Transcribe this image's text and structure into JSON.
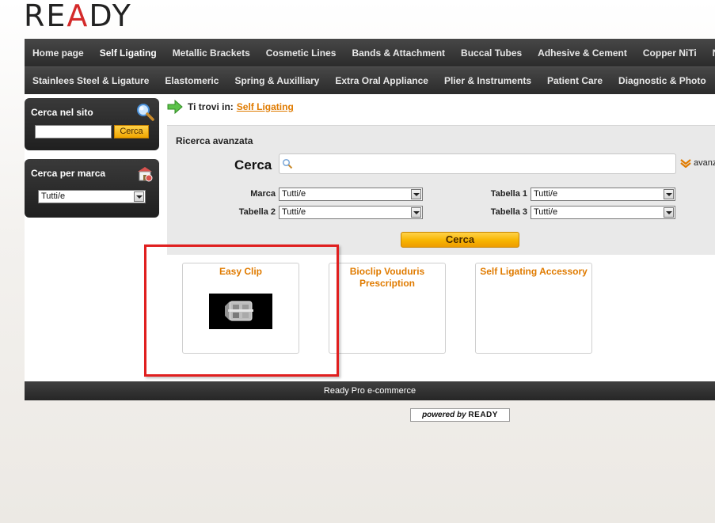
{
  "logo": {
    "text_pre": "RE",
    "text_accent": "A",
    "text_post": "DY"
  },
  "nav_primary": [
    {
      "label": "Home page",
      "active": false
    },
    {
      "label": "Self Ligating",
      "active": true
    },
    {
      "label": "Metallic Brackets",
      "active": false
    },
    {
      "label": "Cosmetic Lines",
      "active": false
    },
    {
      "label": "Bands & Attachment",
      "active": false
    },
    {
      "label": "Buccal Tubes",
      "active": false
    },
    {
      "label": "Adhesive & Cement",
      "active": false
    },
    {
      "label": "Copper NiTi",
      "active": false
    },
    {
      "label": "Ni",
      "active": false
    }
  ],
  "nav_secondary": [
    {
      "label": "Stainlees Steel & Ligature"
    },
    {
      "label": "Elastomeric"
    },
    {
      "label": "Spring & Auxilliary"
    },
    {
      "label": "Extra Oral Appliance"
    },
    {
      "label": "Plier & Instruments"
    },
    {
      "label": "Patient Care"
    },
    {
      "label": "Diagnostic & Photo"
    }
  ],
  "sidebar": {
    "site_search": {
      "title": "Cerca nel sito",
      "value": "",
      "button": "Cerca",
      "icon": "magnifier-icon"
    },
    "brand_search": {
      "title": "Cerca per marca",
      "selected": "Tutti/e",
      "icon": "shop-icon"
    }
  },
  "breadcrumb": {
    "label": "Ti trovi in:",
    "current": "Self Ligating"
  },
  "advanced_search": {
    "title": "Ricerca avanzata",
    "cerca_label": "Cerca",
    "query": "",
    "avanzata_link": "avanz",
    "fields": {
      "marca": {
        "label": "Marca",
        "value": "Tutti/e"
      },
      "tabella1": {
        "label": "Tabella 1",
        "value": "Tutti/e"
      },
      "tabella2": {
        "label": "Tabella 2",
        "value": "Tutti/e"
      },
      "tabella3": {
        "label": "Tabella 3",
        "value": "Tutti/e"
      }
    },
    "submit": "Cerca"
  },
  "categories": [
    {
      "title": "Easy Clip",
      "has_image": true
    },
    {
      "title": "Bioclip Vouduris Prescription",
      "has_image": false
    },
    {
      "title": "Self Ligating Accessory",
      "has_image": false
    }
  ],
  "footer": {
    "text": "Ready Pro e-commerce"
  },
  "powered": {
    "prefix": "powered by",
    "brand": "READY"
  },
  "colors": {
    "accent_orange": "#e07b00",
    "nav_dark": "#2b2b2b",
    "highlight_red": "#e01f1f"
  }
}
